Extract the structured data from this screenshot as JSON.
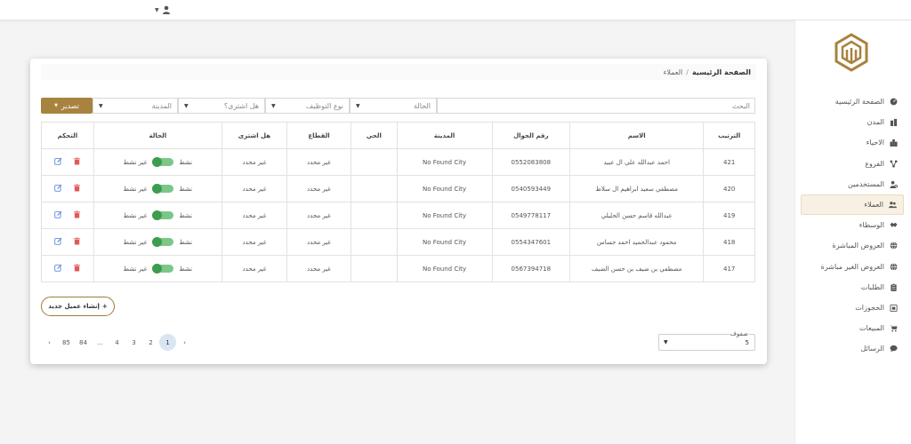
{
  "breadcrumb": {
    "home": "الصفحة الرئيسية",
    "separator": "/",
    "current": "العملاء"
  },
  "sidebar": {
    "items": [
      {
        "label": "الصفحة الرئيسية",
        "icon": "dashboard-icon",
        "active": false
      },
      {
        "label": "المدن",
        "icon": "city-icon",
        "active": false
      },
      {
        "label": "الاحياء",
        "icon": "buildings-icon",
        "active": false
      },
      {
        "label": "الفروع",
        "icon": "branches-icon",
        "active": false
      },
      {
        "label": "المستخدمين",
        "icon": "user-settings-icon",
        "active": false
      },
      {
        "label": "العملاء",
        "icon": "users-icon",
        "active": true
      },
      {
        "label": "الوسطاء",
        "icon": "handshake-icon",
        "active": false
      },
      {
        "label": "العروض المباشرة",
        "icon": "globe-icon",
        "active": false
      },
      {
        "label": "العروض الغير مباشرة",
        "icon": "globe-icon",
        "active": false
      },
      {
        "label": "الطلبات",
        "icon": "clipboard-icon",
        "active": false
      },
      {
        "label": "الحجوزات",
        "icon": "calendar-icon",
        "active": false
      },
      {
        "label": "المبيعات",
        "icon": "cart-icon",
        "active": false
      },
      {
        "label": "الرسائل",
        "icon": "chat-icon",
        "active": false
      }
    ]
  },
  "filters": {
    "search_placeholder": "البحث",
    "status_placeholder": "الحالة",
    "employment_placeholder": "نوع التوظيف",
    "purchased_placeholder": "هل اشترى؟",
    "city_placeholder": "المدينة",
    "export_label": "تصدير"
  },
  "table": {
    "headers": [
      "الترتيب",
      "الاسم",
      "رقم الجوال",
      "المدينة",
      "الحي",
      "القطاع",
      "هل اشترى",
      "الحالة",
      "التحكم"
    ],
    "status_active": "نشط",
    "status_inactive": "غير نشط",
    "rows": [
      {
        "id": "421",
        "name": "احمد عبدالله علي ال عبيد",
        "phone": "0552083808",
        "city": "No Found City",
        "district": "",
        "sector": "غير محدد",
        "purchased": "غير محدد"
      },
      {
        "id": "420",
        "name": "مصطفي سعيد ابراهيم ال سلاط",
        "phone": "0540593449",
        "city": "No Found City",
        "district": "",
        "sector": "غير محدد",
        "purchased": "غير محدد"
      },
      {
        "id": "419",
        "name": "عبدالله قاسم حسن الحليلي",
        "phone": "0549778117",
        "city": "No Found City",
        "district": "",
        "sector": "غير محدد",
        "purchased": "غير محدد"
      },
      {
        "id": "418",
        "name": "محمود عبدالحميد احمد جساس",
        "phone": "0554347601",
        "city": "No Found City",
        "district": "",
        "sector": "غير محدد",
        "purchased": "غير محدد"
      },
      {
        "id": "417",
        "name": "مصطفي بن ضيف بن حسن الضيف",
        "phone": "0567394718",
        "city": "No Found City",
        "district": "",
        "sector": "غير محدد",
        "purchased": "غير محدد"
      }
    ]
  },
  "create_button": {
    "label": "إنشاء عميل جديد",
    "plus": "+"
  },
  "pagination": {
    "prev": "‹",
    "next": "›",
    "pages": [
      "1",
      "2",
      "3",
      "4",
      "…",
      "84",
      "85"
    ],
    "current": "1"
  },
  "rows_per_page": {
    "label": "صفوف",
    "value": "5"
  },
  "colors": {
    "accent": "#a8823f",
    "switch": "#3d9c4e",
    "delete": "#e05a5a",
    "edit": "#4a7bd0"
  }
}
